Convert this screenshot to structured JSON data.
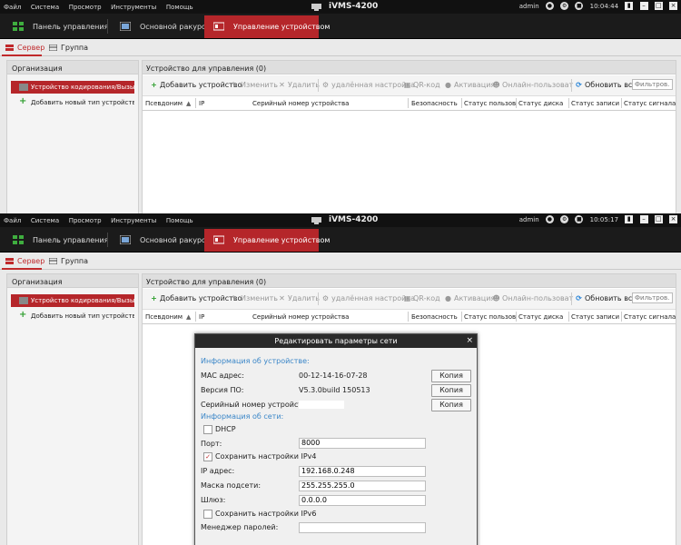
{
  "menubar": {
    "items": [
      "Файл",
      "Система",
      "Просмотр",
      "Инструменты",
      "Помощь"
    ],
    "app_title": "iVMS-4200",
    "user": "admin",
    "time_a": "10:04:44",
    "time_b": "10:05:17"
  },
  "nav": {
    "tabs": [
      {
        "label": "Панель управления",
        "icon": "control-panel-icon"
      },
      {
        "label": "Основной ракурс",
        "icon": "main-view-icon"
      },
      {
        "label": "Управление устройством",
        "icon": "device-management-icon"
      }
    ]
  },
  "subtabs": {
    "server": "Сервер",
    "group": "Группа"
  },
  "left_panel": {
    "title": "Организация",
    "item_selected": "Устройство кодирования/Вызыв...",
    "item_selected_b": "Устройство кодирования/Вызыв...",
    "item_add": "Добавить новый тип устройства"
  },
  "right_panel": {
    "title": "Устройство для управления (0)"
  },
  "toolbar": {
    "add": "Добавить устройство",
    "edit": "Изменить",
    "delete": "Удалить",
    "remote_config": "удалённая настройка",
    "qr": "QR-код",
    "activate": "Активация",
    "online_users": "Онлайн-пользоват",
    "refresh_all": "Обновить все",
    "filter_placeholder": "Фильтров..."
  },
  "table": {
    "columns": [
      "Псевдоним",
      "IP",
      "Серийный номер устройства",
      "Безопасность",
      "Статус пользов...",
      "Статус диска",
      "Статус записи",
      "Статус сигнала"
    ]
  },
  "dialog": {
    "title": "Редактировать параметры сети",
    "device_info_label": "Информация об устройстве:",
    "mac_label": "MAC адрес:",
    "mac_value": "00-12-14-16-07-28",
    "fw_label": "Версия ПО:",
    "fw_value": "V5.3.0build 150513",
    "serial_label": "Серийный номер устройства:",
    "copy_label": "Копия",
    "net_info_label": "Информация об сети:",
    "dhcp_label": "DHCP",
    "port_label": "Порт:",
    "port_value": "8000",
    "save_ipv4_label": "Сохранить настройки IPv4",
    "ip_label": "IP адрес:",
    "ip_value": "192.168.0.248",
    "mask_label": "Маска подсети:",
    "mask_value": "255.255.255.0",
    "gateway_label": "Шлюз:",
    "gateway_value": "0.0.0.0",
    "save_ipv6_label": "Сохранить настройки IPv6",
    "pwd_label": "Менеджер паролей:",
    "dhcp_checked": false,
    "ipv4_checked": true,
    "ipv6_checked": false
  },
  "colors": {
    "accent_red": "#b5262a",
    "link_blue": "#3a86c8",
    "add_green": "#2e9e2e",
    "refresh_blue": "#1e7fd6"
  }
}
